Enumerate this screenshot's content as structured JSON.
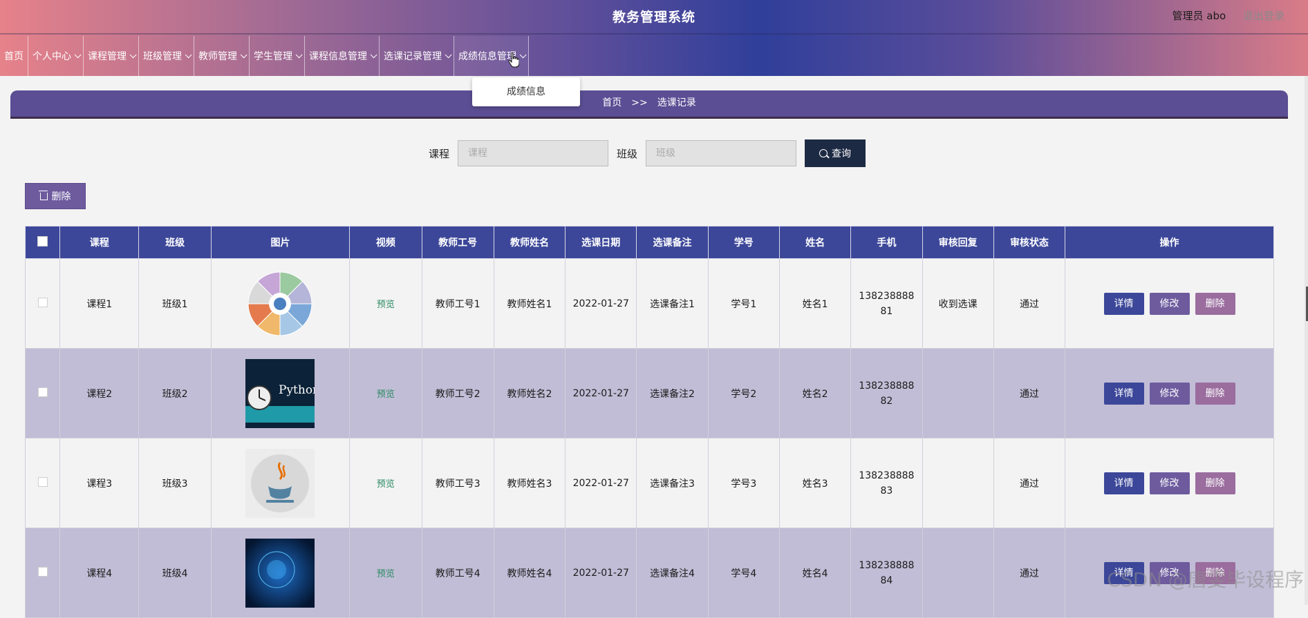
{
  "app": {
    "title": "教务管理系统",
    "user": "管理员 abo",
    "logout": "退出登录"
  },
  "nav": [
    {
      "label": "首页",
      "has_menu": false
    },
    {
      "label": "个人中心",
      "has_menu": true
    },
    {
      "label": "课程管理",
      "has_menu": true
    },
    {
      "label": "班级管理",
      "has_menu": true
    },
    {
      "label": "教师管理",
      "has_menu": true
    },
    {
      "label": "学生管理",
      "has_menu": true
    },
    {
      "label": "课程信息管理",
      "has_menu": true
    },
    {
      "label": "选课记录管理",
      "has_menu": true
    },
    {
      "label": "成绩信息管理",
      "has_menu": true,
      "hovered": true
    }
  ],
  "dropdown": {
    "item": "成绩信息"
  },
  "breadcrumb": {
    "home": "首页",
    "sep": ">>",
    "current": "选课记录"
  },
  "search": {
    "course_label": "课程",
    "course_placeholder": "课程",
    "class_label": "班级",
    "class_placeholder": "班级",
    "query_label": "查询"
  },
  "toolbar": {
    "delete_label": "删除"
  },
  "table": {
    "columns": [
      "课程",
      "班级",
      "图片",
      "视频",
      "教师工号",
      "教师姓名",
      "选课日期",
      "选课备注",
      "学号",
      "姓名",
      "手机",
      "审核回复",
      "审核状态",
      "操作"
    ],
    "actions": {
      "detail": "详情",
      "edit": "修改",
      "delete": "删除"
    },
    "rows": [
      {
        "course": "课程1",
        "class": "班级1",
        "image": "chart-wheel-image",
        "video": "预览",
        "teacher_no": "教师工号1",
        "teacher_name": "教师姓名1",
        "date": "2022-01-27",
        "remark": "选课备注1",
        "student_no": "学号1",
        "name": "姓名1",
        "phone1": "138238888",
        "phone2": "81",
        "reply": "收到选课",
        "status": "通过"
      },
      {
        "course": "课程2",
        "class": "班级2",
        "image": "python-clock-image",
        "image_text": "Python",
        "video": "预览",
        "teacher_no": "教师工号2",
        "teacher_name": "教师姓名2",
        "date": "2022-01-27",
        "remark": "选课备注2",
        "student_no": "学号2",
        "name": "姓名2",
        "phone1": "138238888",
        "phone2": "82",
        "reply": "",
        "status": "通过"
      },
      {
        "course": "课程3",
        "class": "班级3",
        "image": "java-logo-image",
        "video": "预览",
        "teacher_no": "教师工号3",
        "teacher_name": "教师姓名3",
        "date": "2022-01-27",
        "remark": "选课备注3",
        "student_no": "学号3",
        "name": "姓名3",
        "phone1": "138238888",
        "phone2": "83",
        "reply": "",
        "status": "通过"
      },
      {
        "course": "课程4",
        "class": "班级4",
        "image": "blue-tech-image",
        "video": "预览",
        "teacher_no": "教师工号4",
        "teacher_name": "教师姓名4",
        "date": "2022-01-27",
        "remark": "选课备注4",
        "student_no": "学号4",
        "name": "姓名4",
        "phone1": "138238888",
        "phone2": "84",
        "reply": "",
        "status": "通过"
      }
    ]
  },
  "watermark": "CSDN @唐雯毕设程序"
}
